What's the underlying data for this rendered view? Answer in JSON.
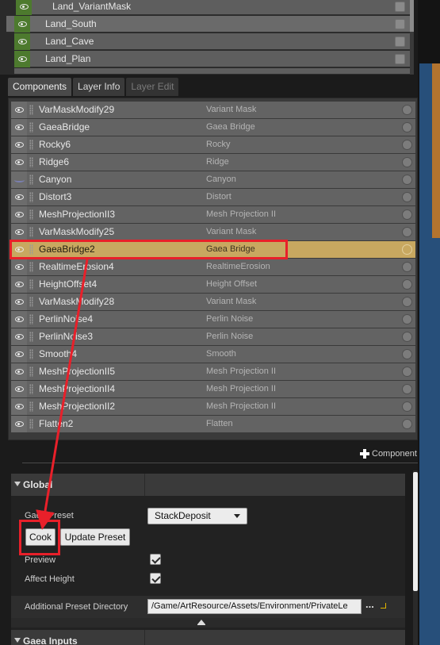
{
  "layer_list": {
    "items": [
      {
        "label": "Land_VariantMask"
      },
      {
        "label": "Land_South"
      },
      {
        "label": "Land_Cave"
      },
      {
        "label": "Land_Plan"
      }
    ]
  },
  "tabs": [
    {
      "label": "Components"
    },
    {
      "label": "Layer Info"
    },
    {
      "label": "Layer Edit"
    }
  ],
  "components": [
    {
      "name": "VarMaskModify29",
      "type": "Variant Mask"
    },
    {
      "name": "GaeaBridge",
      "type": "Gaea Bridge"
    },
    {
      "name": "Rocky6",
      "type": "Rocky"
    },
    {
      "name": "Ridge6",
      "type": "Ridge"
    },
    {
      "name": "Canyon",
      "type": "Canyon"
    },
    {
      "name": "Distort3",
      "type": "Distort"
    },
    {
      "name": "MeshProjectionII3",
      "type": "Mesh Projection II"
    },
    {
      "name": "VarMaskModify25",
      "type": "Variant Mask"
    },
    {
      "name": "GaeaBridge2",
      "type": "Gaea Bridge"
    },
    {
      "name": "RealtimeErosion4",
      "type": "RealtimeErosion"
    },
    {
      "name": "HeightOffset4",
      "type": "Height Offset"
    },
    {
      "name": "VarMaskModify28",
      "type": "Variant Mask"
    },
    {
      "name": "PerlinNoise4",
      "type": "Perlin Noise"
    },
    {
      "name": "PerlinNoise3",
      "type": "Perlin Noise"
    },
    {
      "name": "Smooth4",
      "type": "Smooth"
    },
    {
      "name": "MeshProjectionII5",
      "type": "Mesh Projection II"
    },
    {
      "name": "MeshProjectionII4",
      "type": "Mesh Projection II"
    },
    {
      "name": "MeshProjectionII2",
      "type": "Mesh Projection II"
    },
    {
      "name": "Flatten2",
      "type": "Flatten"
    }
  ],
  "add_component_label": "Component",
  "details": {
    "global_title": "Global",
    "gaea_preset_label": "Gaea Preset",
    "gaea_preset_value": "StackDeposit",
    "cook_label": "Cook",
    "update_preset_label": "Update Preset",
    "preview_label": "Preview",
    "affect_height_label": "Affect Height",
    "preset_dir_label": "Additional Preset Directory",
    "preset_dir_value": "/Game/ArtResource/Assets/Environment/PrivateLe",
    "browse_label": "...",
    "gaea_inputs_title": "Gaea Inputs"
  },
  "icons": {
    "visibility": "eye-icon",
    "drag": "drag-handle-icon",
    "status": "status-dot-icon",
    "add": "plus-icon",
    "dropdown": "chevron-down-icon",
    "collapse": "triangle-down-icon",
    "reset": "reset-arrow-icon",
    "expand": "eject-icon"
  },
  "colors": {
    "selected_row": "#c8a860",
    "annotation": "#e8202a",
    "eye_cell_active": "#4d7a2e"
  },
  "selected_component_index": 8
}
